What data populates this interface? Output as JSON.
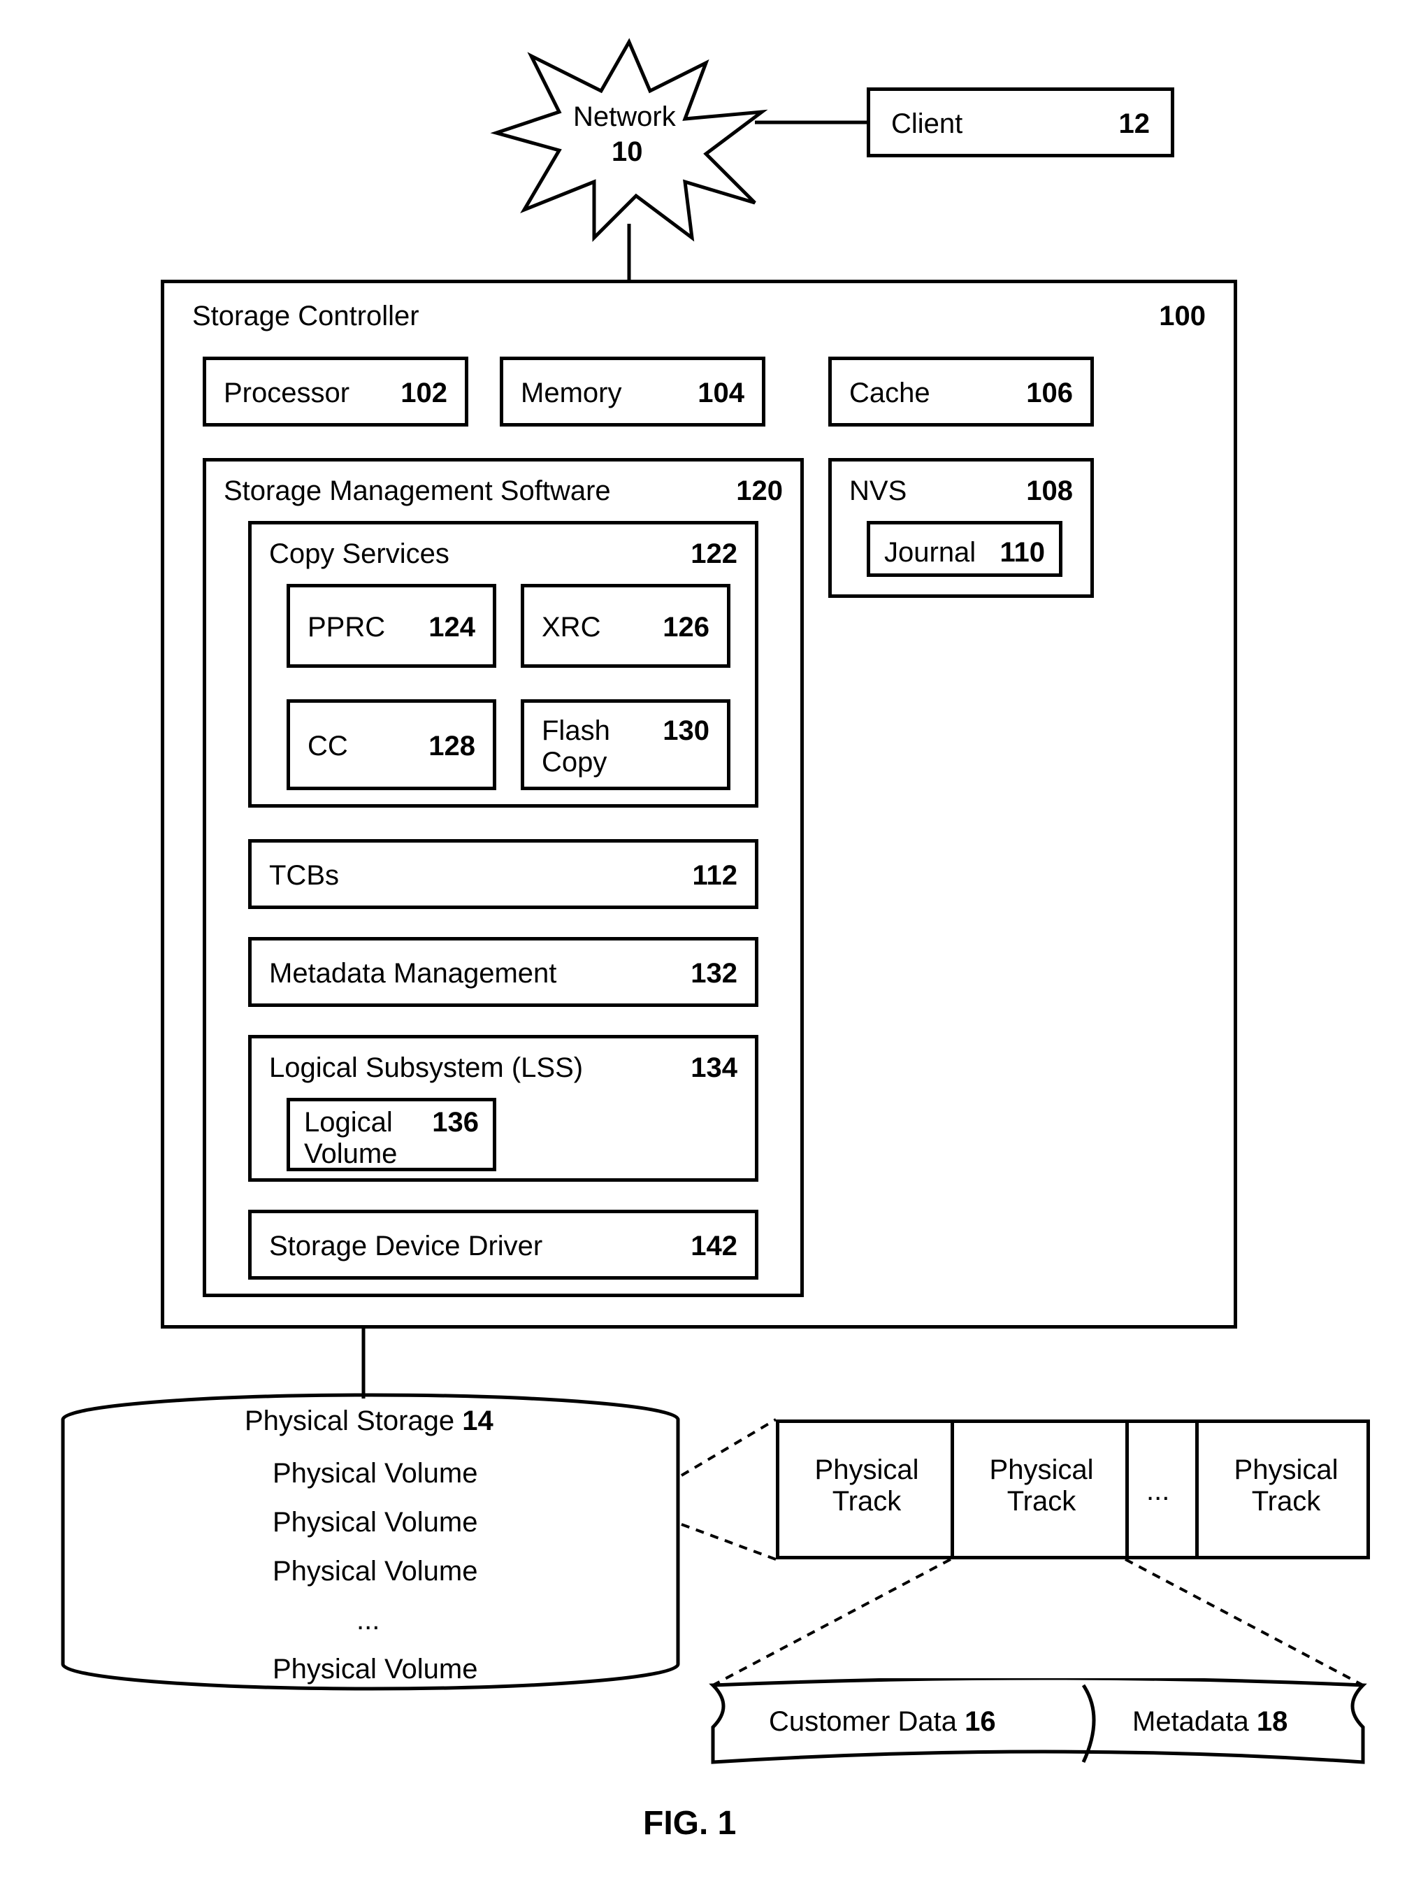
{
  "network": {
    "label": "Network",
    "num": "10"
  },
  "client": {
    "label": "Client",
    "num": "12"
  },
  "storage_controller": {
    "label": "Storage Controller",
    "num": "100",
    "processor": {
      "label": "Processor",
      "num": "102"
    },
    "memory": {
      "label": "Memory",
      "num": "104"
    },
    "cache": {
      "label": "Cache",
      "num": "106"
    },
    "nvs": {
      "label": "NVS",
      "num": "108",
      "journal": {
        "label": "Journal",
        "num": "110"
      }
    },
    "sms": {
      "label": "Storage Management Software",
      "num": "120",
      "copy_services": {
        "label": "Copy Services",
        "num": "122",
        "pprc": {
          "label": "PPRC",
          "num": "124"
        },
        "xrc": {
          "label": "XRC",
          "num": "126"
        },
        "cc": {
          "label": "CC",
          "num": "128"
        },
        "flash": {
          "label": "Flash Copy",
          "num": "130"
        }
      },
      "tcbs": {
        "label": "TCBs",
        "num": "112"
      },
      "metadata": {
        "label": "Metadata Management",
        "num": "132"
      },
      "lss": {
        "label": "Logical Subsystem (LSS)",
        "num": "134",
        "lv": {
          "label": "Logical Volume",
          "num": "136"
        }
      },
      "driver": {
        "label": "Storage Device Driver",
        "num": "142"
      }
    }
  },
  "physical_storage": {
    "label": "Physical Storage",
    "num": "14",
    "volume": "Physical Volume",
    "ellipsis": "..."
  },
  "tracks": {
    "label": "Physical Track",
    "ellipsis": "..."
  },
  "customer_data": {
    "label": "Customer Data",
    "num": "16"
  },
  "metadata_detail": {
    "label": "Metadata",
    "num": "18"
  },
  "fig": "FIG. 1"
}
